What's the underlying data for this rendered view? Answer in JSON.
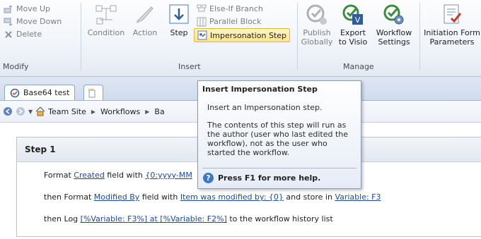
{
  "ribbon": {
    "modify": {
      "label": "Modify",
      "move_up": "Move Up",
      "move_down": "Move Down",
      "delete": "Delete"
    },
    "insert": {
      "label": "Insert",
      "condition": "Condition",
      "action": "Action",
      "step": "Step",
      "else_if_branch": "Else-If Branch",
      "parallel_block": "Parallel Block",
      "impersonation_step": "Impersonation Step"
    },
    "manage": {
      "label": "Manage",
      "publish_globally": [
        "Publish",
        "Globally"
      ],
      "export_to_visio": [
        "Export",
        "to Visio"
      ],
      "workflow_settings": [
        "Workflow",
        "Settings"
      ]
    },
    "initiation_form": [
      "Initiation Form",
      "Parameters"
    ]
  },
  "tabs": [
    {
      "label": "Base64 test"
    }
  ],
  "breadcrumb": {
    "items": [
      "Team Site",
      "Workflows",
      "Ba"
    ]
  },
  "step": {
    "title": "Step 1",
    "lines": [
      {
        "p1": "Format ",
        "l1": "Created",
        "p2": " field with ",
        "l2": "{0:yyyy-MM",
        "p3": "",
        "l3": "",
        "p4": "",
        "l4": "",
        "p5": ""
      },
      {
        "p1": "then Format ",
        "l1": "Modified By",
        "p2": " field with ",
        "l2": "Item was modified by: {0}",
        "p3": " and store in ",
        "l3": "Variable: F3",
        "p4": "",
        "l4": "",
        "p5": ""
      },
      {
        "p1": "then Log ",
        "l1": "[%Variable: F3%] at [%Variable: F2%]",
        "p2": "  to the workflow history list",
        "l2": "",
        "p3": "",
        "l3": "",
        "p4": "",
        "l4": "",
        "p5": ""
      }
    ]
  },
  "tooltip": {
    "title": "Insert Impersonation Step",
    "line1": "Insert an Impersonation step.",
    "line2": "The contents of this step will run as the author (user who last edited the workflow), not as the user who started the workflow.",
    "help": "Press F1 for more help."
  },
  "colors": {
    "link": "#1b4aa0",
    "highlight": "#ffe48a",
    "help_icon": "#3a79c8"
  }
}
